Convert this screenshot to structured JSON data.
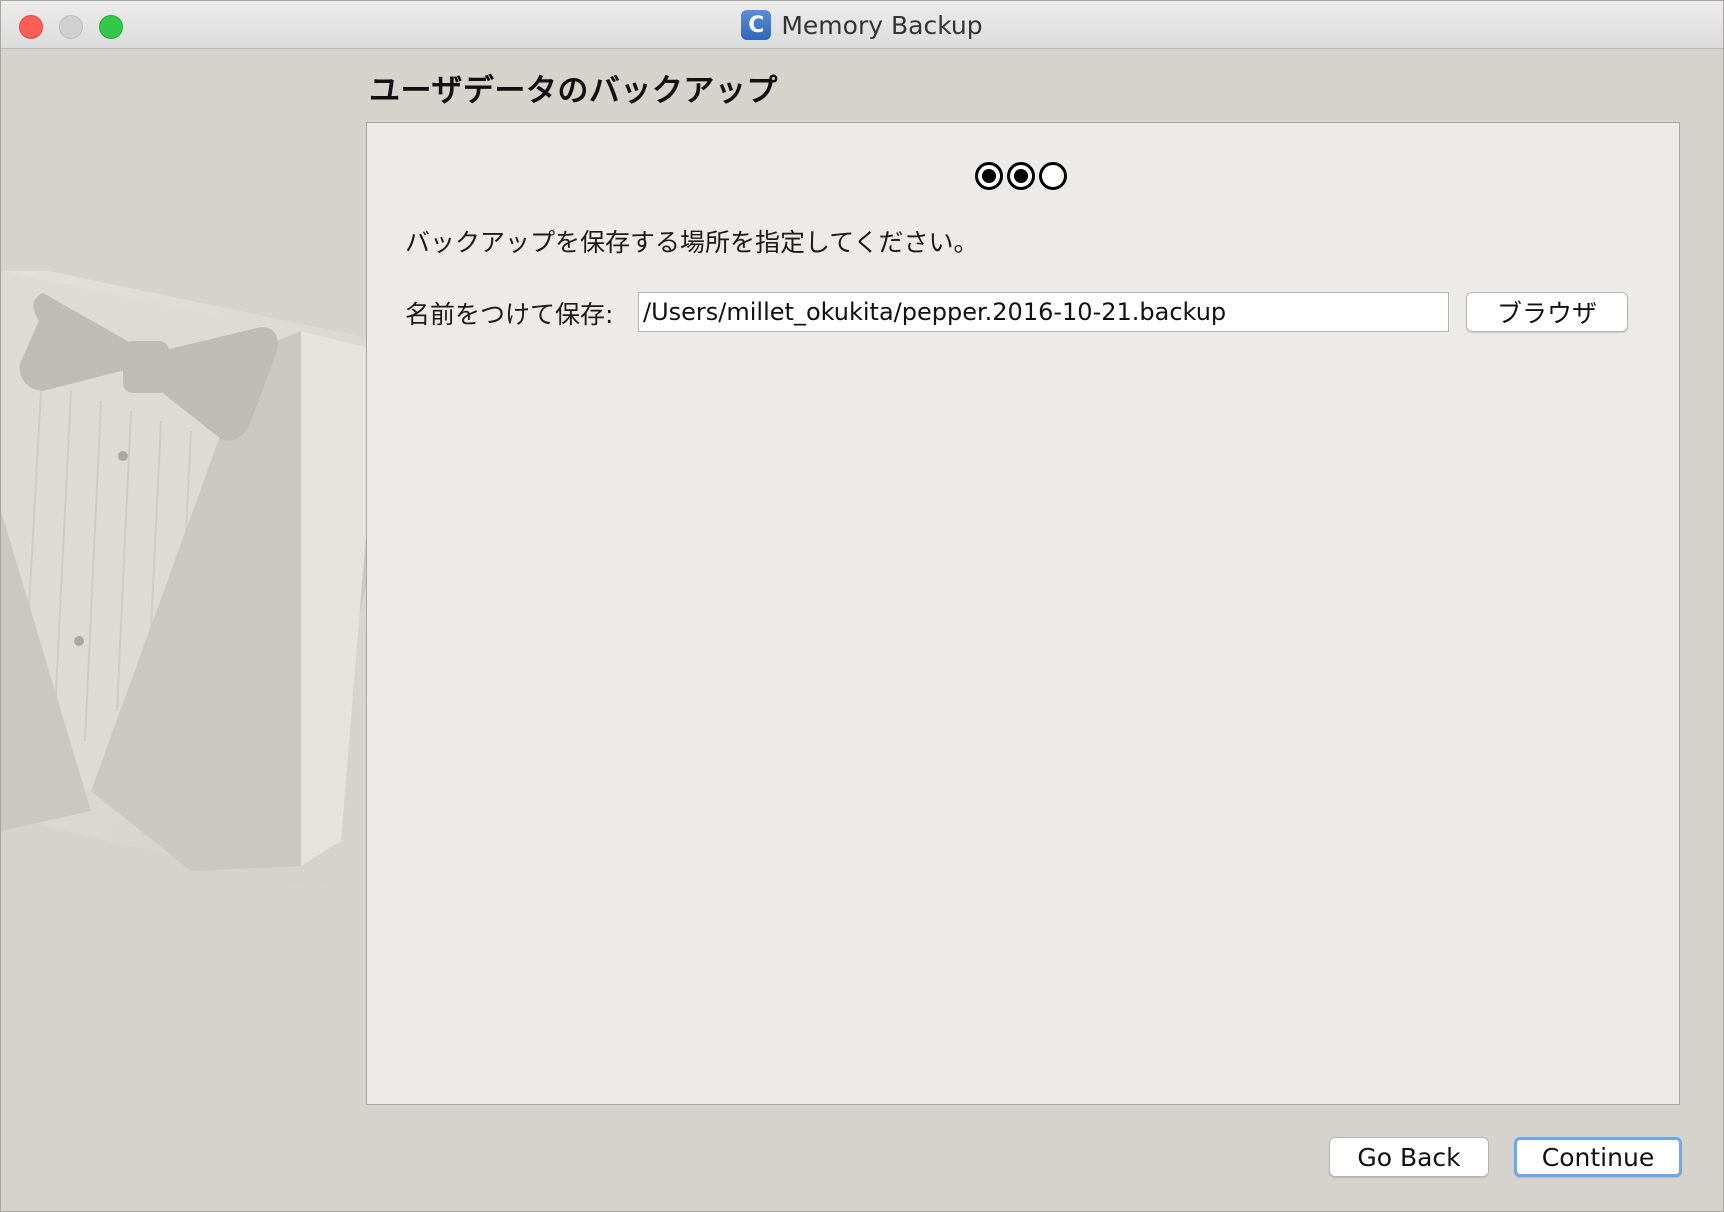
{
  "window": {
    "title": "Memory Backup",
    "app_icon_letter": "C"
  },
  "page": {
    "title": "ユーザデータのバックアップ"
  },
  "steps": {
    "total": 3,
    "completed": 2
  },
  "form": {
    "instruction": "バックアップを保存する場所を指定してください。",
    "save_label": "名前をつけて保存:",
    "path_value": "/Users/millet_okukita/pepper.2016-10-21.backup",
    "browse_label": "ブラウザ"
  },
  "footer": {
    "back_label": "Go Back",
    "continue_label": "Continue"
  },
  "colors": {
    "window_bg": "#d6d2cc",
    "panel_bg": "#edebe7",
    "close": "#fc5f57",
    "zoom": "#34c749",
    "focus_ring": "#6ea7e8"
  }
}
